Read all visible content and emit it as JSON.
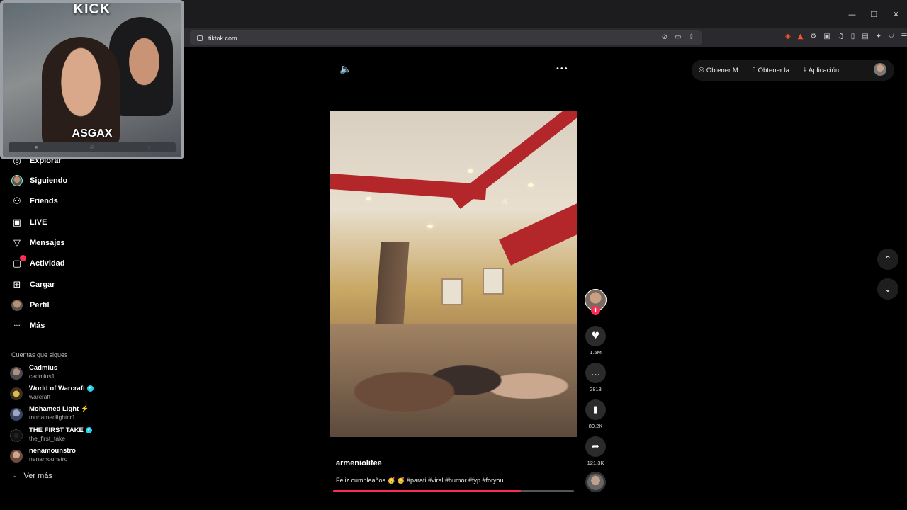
{
  "browser": {
    "url": "tiktok.com",
    "window_controls": [
      "—",
      "❐",
      "✕"
    ],
    "url_actions": [
      "⊘",
      "▭",
      "⇪"
    ],
    "extensions": [
      "◈",
      "▲",
      "⚙",
      "▣",
      "♫",
      "▯",
      "▤",
      "✦",
      "⛉",
      "☰"
    ]
  },
  "stream_overlay": {
    "platform": "KICK",
    "streamer": "ASGAX",
    "bar_items": [
      "■ ",
      "◎ ",
      "◌ "
    ]
  },
  "sidebar": {
    "items": [
      {
        "label": "Explorar",
        "icon": "compass-icon",
        "glyph": "◎"
      },
      {
        "label": "Siguiendo",
        "icon": "avatar",
        "glyph": ""
      },
      {
        "label": "Friends",
        "icon": "friends-icon",
        "glyph": "⚇"
      },
      {
        "label": "LIVE",
        "icon": "live-icon",
        "glyph": "▣"
      },
      {
        "label": "Mensajes",
        "icon": "messages-icon",
        "glyph": "▽"
      },
      {
        "label": "Actividad",
        "icon": "activity-icon",
        "glyph": "▢",
        "badge": "1"
      },
      {
        "label": "Cargar",
        "icon": "upload-icon",
        "glyph": "⊞"
      },
      {
        "label": "Perfil",
        "icon": "avatar",
        "glyph": ""
      },
      {
        "label": "Más",
        "icon": "more-icon",
        "glyph": "···"
      }
    ],
    "following_title": "Cuentas que sigues",
    "following": [
      {
        "name": "Cadmius",
        "handle": "cadmius1",
        "verified": false,
        "extra": ""
      },
      {
        "name": "World of Warcraft",
        "handle": "warcraft",
        "verified": true,
        "extra": ""
      },
      {
        "name": "Mohamed Light",
        "handle": "mohamedlightcr1",
        "verified": false,
        "extra": "⚡"
      },
      {
        "name": "THE FIRST TAKE",
        "handle": "the_first_take",
        "verified": true,
        "extra": ""
      },
      {
        "name": "nenamounstro",
        "handle": "nenamounstro",
        "verified": false,
        "extra": ""
      }
    ],
    "see_more": "Ver más"
  },
  "video": {
    "volume_icon": "🔈",
    "more_icon": "•••",
    "author": "armeniolifee",
    "caption": "Feliz cumpleaños 🥳 🥳 #parati #viral #humor #fyp #foryou",
    "progress": 0.78
  },
  "actions": {
    "likes": "1.5M",
    "comments": "2813",
    "saves": "80.2K",
    "shares": "121.3K"
  },
  "top_right": {
    "pills": [
      {
        "icon": "◎",
        "label": "Obtener M..."
      },
      {
        "icon": "▯",
        "label": "Obtener la..."
      },
      {
        "icon": "⤓",
        "label": "Aplicación..."
      }
    ]
  },
  "colors": {
    "accent": "#fe2c55",
    "verified": "#20d5ec",
    "background": "#000000"
  }
}
